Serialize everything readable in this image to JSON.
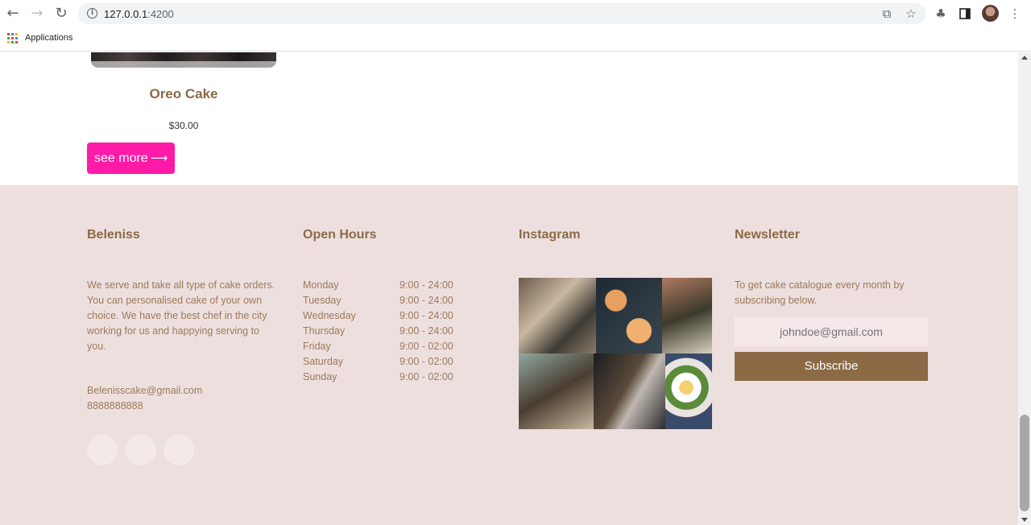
{
  "browser": {
    "url_host": "127.0.0.1",
    "url_port": ":4200",
    "bookmarks_label": "Applications"
  },
  "icons": {
    "back": "arrow-left",
    "forward": "arrow-right",
    "reload": "refresh",
    "info": "info-circle",
    "share": "share",
    "star": "star",
    "extensions": "puzzle",
    "sidepanel": "side-panel",
    "menu": "kebab",
    "see_more_arrow": "arrow-right"
  },
  "colors": {
    "accent_pink": "#ff1aa8",
    "brand_brown": "#8b6a45",
    "footer_bg": "#eedfdf"
  },
  "product": {
    "name": "Oreo Cake",
    "price": "$30.00",
    "button_label": "see more"
  },
  "footer": {
    "brand": {
      "heading": "Beleniss",
      "description": "We serve and take all type of cake orders. You can personalised cake of your own choice. We have the best chef in the city working for us and happying serving to you.",
      "email": "Belenisscake@gmail.com",
      "phone": "8888888888"
    },
    "hours": {
      "heading": "Open Hours",
      "rows": [
        {
          "day": "Monday",
          "time": "9:00 - 24:00"
        },
        {
          "day": "Tuesday",
          "time": "9:00 - 24:00"
        },
        {
          "day": "Wednesday",
          "time": "9:00 - 24:00"
        },
        {
          "day": "Thursday",
          "time": "9:00 - 24:00"
        },
        {
          "day": "Friday",
          "time": "9:00 - 02:00"
        },
        {
          "day": "Saturday",
          "time": "9:00 - 02:00"
        },
        {
          "day": "Sunday",
          "time": "9:00 - 02:00"
        }
      ]
    },
    "instagram": {
      "heading": "Instagram"
    },
    "newsletter": {
      "heading": "Newsletter",
      "description": "To get cake catalogue every month by subscribing below.",
      "email_placeholder": "johndoe@gmail.com",
      "button_label": "Subscribe"
    }
  }
}
